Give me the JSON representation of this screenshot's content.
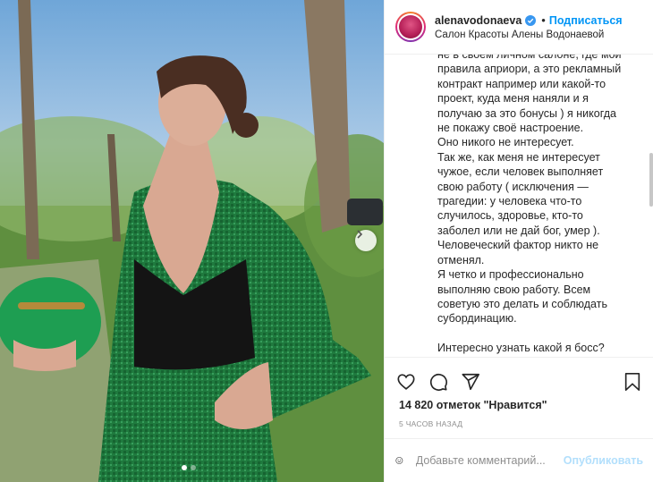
{
  "post": {
    "photo_alt": "",
    "carousel_dots": 2,
    "active_dot": 0
  },
  "header": {
    "username": "alenavodonaeva",
    "separator": "•",
    "follow_label": "Подписаться",
    "location": "Салон Красоты Алены Водонаевой"
  },
  "caption": {
    "text": "не в своём личном салоне, где мои\nправила априори, а это рекламный\nконтракт например или какой-то\nпроект, куда меня наняли и я\nполучаю за это бонусы ) я никогда\nне покажу своё настроение.\nОно никого не интересует.\nТак же, как меня не интересует\nчужое, если человек выполняет\nсвою работу ( исключения —\nтрагедии: у человека что-то\nслучилось, здоровье, кто-то\nзаболел или не дай бог, умер ).\nЧеловеческий фактор никто не\nотменял.\nЯ четко и профессионально\nвыполняю свою работу. Всем\nсоветую это делать и соблюдать\nсубординацию.\n\nИнтересно узнать какой я босс?\nПланирую делать собрание на"
  },
  "stats": {
    "likes": "14 820 отметок \"Нравится\"",
    "time": "5 ЧАСОВ НАЗАД"
  },
  "comment": {
    "placeholder": "Добавьте комментарий...",
    "publish_label": "Опубликовать"
  },
  "icons": {
    "like": "heart-icon",
    "comment": "comment-icon",
    "share": "share-icon",
    "save": "bookmark-icon",
    "emoji": "emoji-icon",
    "verified": "verified-badge-icon",
    "next": "chevron-right-icon"
  },
  "colors": {
    "link_blue": "#0095f6",
    "publish_disabled": "#b2dffc",
    "muted": "#8e8e8e",
    "border": "#efefef"
  }
}
